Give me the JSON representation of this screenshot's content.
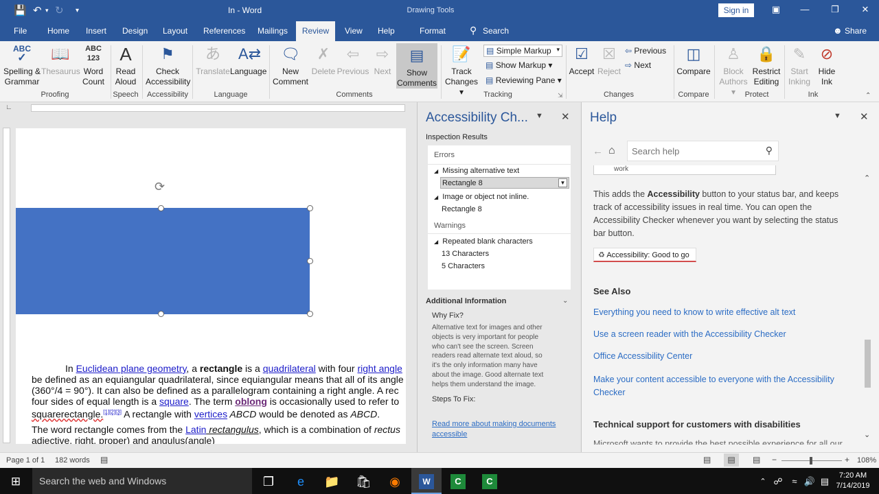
{
  "window": {
    "doc_title": "In - Word",
    "drawing_tools": "Drawing Tools",
    "sign_in": "Sign in"
  },
  "tabs": {
    "file": "File",
    "home": "Home",
    "insert": "Insert",
    "design": "Design",
    "layout": "Layout",
    "references": "References",
    "mailings": "Mailings",
    "review": "Review",
    "view": "View",
    "help": "Help",
    "format": "Format",
    "search": "Search",
    "share": "Share"
  },
  "ribbon": {
    "spelling": "Spelling &",
    "grammar": "Grammar",
    "thesaurus": "Thesaurus",
    "word": "Word",
    "count": "Count",
    "read": "Read",
    "aloud": "Aloud",
    "check": "Check",
    "accessibility": "Accessibility",
    "translate": "Translate",
    "language": "Language",
    "new": "New",
    "comment": "Comment",
    "delete": "Delete",
    "previous": "Previous",
    "next": "Next",
    "show": "Show",
    "comments": "Comments",
    "track": "Track",
    "changes": "Changes ▾",
    "simple_markup": "Simple Markup",
    "show_markup": "Show Markup ▾",
    "reviewing_pane": "Reviewing Pane ▾",
    "accept": "Accept",
    "reject": "Reject",
    "prev_change": "Previous",
    "next_change": "Next",
    "compare": "Compare",
    "block": "Block",
    "authors": "Authors ▾",
    "restrict": "Restrict",
    "editing": "Editing",
    "start": "Start",
    "inking": "Inking",
    "hide": "Hide",
    "ink": "Ink",
    "groups": {
      "proofing": "Proofing",
      "speech": "Speech",
      "accessibility": "Accessibility",
      "language": "Language",
      "comments": "Comments",
      "tracking": "Tracking",
      "changes": "Changes",
      "compare": "Compare",
      "protect": "Protect",
      "ink": "Ink"
    }
  },
  "document": {
    "p1_l1_a": "In ",
    "p1_l1_link1": "Euclidean plane geometry",
    "p1_l1_b": ", a ",
    "p1_l1_bold": "rectangle",
    "p1_l1_c": " is a ",
    "p1_l1_link2": "quadrilateral",
    "p1_l1_d": " with four ",
    "p1_l1_link3": "right angle",
    "p1_l2": "be defined as an equiangular quadrilateral, since equiangular means that all of its angle",
    "p1_l3": "(360°/4 = 90°). It can also be defined as a parallelogram containing a right angle. A rec",
    "p1_l4_a": "four sides of equal length is a ",
    "p1_l4_link": "square",
    "p1_l4_b": ". The term ",
    "p1_l4_bold": "oblong",
    "p1_l4_c": " is occasionally used to refer to",
    "p1_l5_a": "squarerectangle.",
    "p1_l5_ref": "[1][2][3]",
    "p1_l5_b": " A rectangle with ",
    "p1_l5_link": "vertices",
    "p1_l5_c": " ABCD",
    "p1_l5_d": " would be denoted as ",
    "p1_l5_e": "ABCD",
    "p1_l5_f": ".",
    "p2_l1_a": "The word rectangle comes from the ",
    "p2_l1_link": "Latin",
    "p2_l1_b": " rectangulus",
    "p2_l1_c": ", which is a combination of ",
    "p2_l1_d": "rectus",
    "p2_l2": "adjective, right, proper) and angulus(angle)"
  },
  "accessibility": {
    "title": "Accessibility Ch...",
    "inspection_results": "Inspection Results",
    "errors": "Errors",
    "missing_alt": "Missing alternative text",
    "rect8_a": "Rectangle 8",
    "not_inline": "Image or object not inline.",
    "rect8_b": "Rectangle 8",
    "warnings": "Warnings",
    "repeated_blank": "Repeated blank characters",
    "chars13": "13 Characters",
    "chars5": "5 Characters",
    "additional_info": "Additional Information",
    "why_fix": "Why Fix?",
    "why_l1": "Alternative text for images and other",
    "why_l2": "objects is very important for people",
    "why_l3": "who can't see the screen. Screen",
    "why_l4": "readers read alternate text aloud, so",
    "why_l5": "it's the only information many have",
    "why_l6": "about the image. Good alternate text",
    "why_l7": "helps them understand the image.",
    "steps": "Steps To Fix:",
    "read_more_l1": "Read more about making documents",
    "read_more_l2": "accessible"
  },
  "help": {
    "title": "Help",
    "search_placeholder": "Search help",
    "work": "work",
    "body_l1_a": "This adds the ",
    "body_l1_bold": "Accessibility",
    "body_l1_b": " button to your status bar, and keeps",
    "body_l2": "track of accessibility issues in real time. You can open the",
    "body_l3": "Accessibility Checker whenever you want by selecting the status",
    "body_l4": "bar button.",
    "status_button": "Accessibility: Good to go",
    "see_also": "See Also",
    "link1": "Everything you need to know to write effective alt text",
    "link2": "Use a screen reader with the Accessibility Checker",
    "link3": "Office Accessibility Center",
    "link4_l1": "Make your content accessible to everyone with the Accessibility",
    "link4_l2": "Checker",
    "tech_support": "Technical support for customers with disabilities",
    "cut_text": "Microsoft wants to provide the best possible experience for all our"
  },
  "statusbar": {
    "page": "Page 1 of 1",
    "words": "182 words",
    "zoom": "108%"
  },
  "taskbar": {
    "search": "Search the web and Windows",
    "time": "7:20 AM",
    "date": "7/14/2019"
  },
  "colors": {
    "word_blue": "#2b579a",
    "shape_fill": "#4472c4",
    "link": "#2b6cc4"
  }
}
